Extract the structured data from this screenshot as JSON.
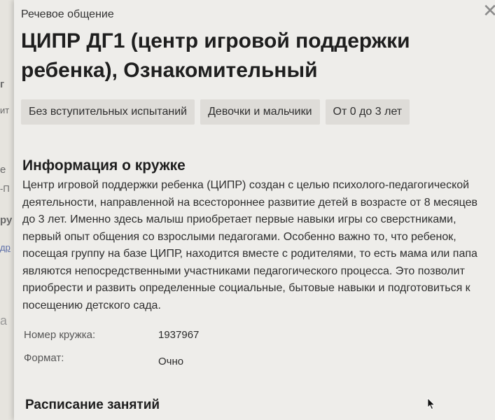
{
  "background_sidebar": {
    "fragments": [
      "г",
      "ит",
      "е",
      "-П",
      "ру",
      "др",
      "а"
    ]
  },
  "panel": {
    "category": "Речевое общение",
    "title": "ЦИПР ДГ1 (центр игровой поддержки ребенка), Ознакомительный",
    "tags": [
      "Без вступительных испытаний",
      "Девочки и мальчики",
      "От 0 до 3 лет"
    ],
    "info_section": {
      "heading": "Информация о кружке",
      "description": "Центр игровой поддержки ребенка (ЦИПР) создан с целью психолого-педагогической деятельности, направленной на всестороннее развитие детей в возрасте от 8 месяцев до 3 лет. Именно здесь малыш приобретает первые навыки игры со сверстниками, первый опыт общения со взрослыми педагогами. Особенно важно то, что ребенок, посещая группу на базе ЦИПР, находится вместе с родителями, то есть мама или папа являются непосредственными участниками педагогического процесса. Это позволит приобрести и развить определенные социальные, бытовые навыки и подготовиться к посещению детского сада."
    },
    "details": {
      "number_label": "Номер кружка:",
      "number_value": "1937967",
      "format_label": "Формат:",
      "format_value": "Очно"
    },
    "schedule_heading": "Расписание занятий"
  }
}
